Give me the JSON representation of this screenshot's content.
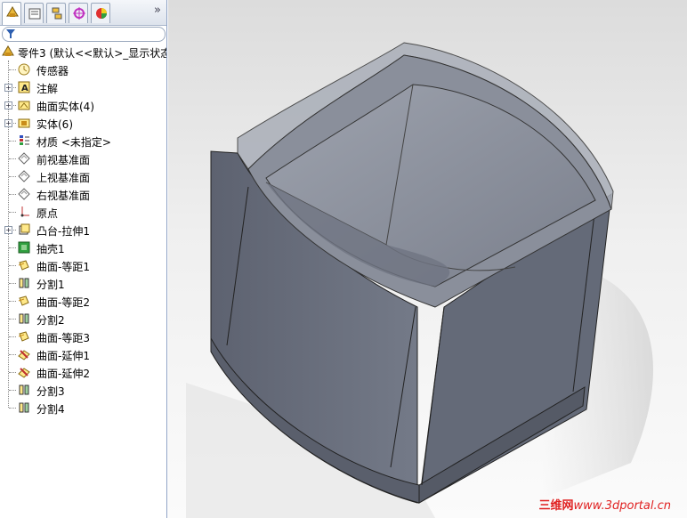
{
  "tree": {
    "root": "零件3 (默认<<默认>_显示状态",
    "items": [
      {
        "label": "传感器",
        "icon": "sensor-icon",
        "expandable": false
      },
      {
        "label": "注解",
        "icon": "annotation-icon",
        "expandable": true
      },
      {
        "label": "曲面实体(4)",
        "icon": "surface-bodies-icon",
        "expandable": true
      },
      {
        "label": "实体(6)",
        "icon": "solid-bodies-icon",
        "expandable": true
      },
      {
        "label": "材质 <未指定>",
        "icon": "material-icon",
        "expandable": false
      },
      {
        "label": "前视基准面",
        "icon": "plane-icon",
        "expandable": false
      },
      {
        "label": "上视基准面",
        "icon": "plane-icon",
        "expandable": false
      },
      {
        "label": "右视基准面",
        "icon": "plane-icon",
        "expandable": false
      },
      {
        "label": "原点",
        "icon": "origin-icon",
        "expandable": false
      },
      {
        "label": "凸台-拉伸1",
        "icon": "boss-extrude-icon",
        "expandable": true
      },
      {
        "label": "抽壳1",
        "icon": "shell-icon",
        "expandable": false
      },
      {
        "label": "曲面-等距1",
        "icon": "offset-surface-icon",
        "expandable": false
      },
      {
        "label": "分割1",
        "icon": "split-icon",
        "expandable": false
      },
      {
        "label": "曲面-等距2",
        "icon": "offset-surface-icon",
        "expandable": false
      },
      {
        "label": "分割2",
        "icon": "split-icon",
        "expandable": false
      },
      {
        "label": "曲面-等距3",
        "icon": "offset-surface-icon",
        "expandable": false
      },
      {
        "label": "曲面-延伸1",
        "icon": "extend-surface-icon",
        "expandable": false
      },
      {
        "label": "曲面-延伸2",
        "icon": "extend-surface-icon",
        "expandable": false
      },
      {
        "label": "分割3",
        "icon": "split-icon",
        "expandable": false
      },
      {
        "label": "分割4",
        "icon": "split-icon",
        "expandable": false
      }
    ]
  },
  "tabs": [
    "feature-manager-tab",
    "property-manager-tab",
    "configuration-manager-tab",
    "dimxpert-tab",
    "display-manager-tab"
  ],
  "more_glyph": "»",
  "watermark": {
    "brand": "三维网",
    "url": "www.3dportal.cn"
  },
  "colors": {
    "panel_border": "#8da2c4",
    "model_face": "#6c7280",
    "watermark": "#e02020"
  }
}
